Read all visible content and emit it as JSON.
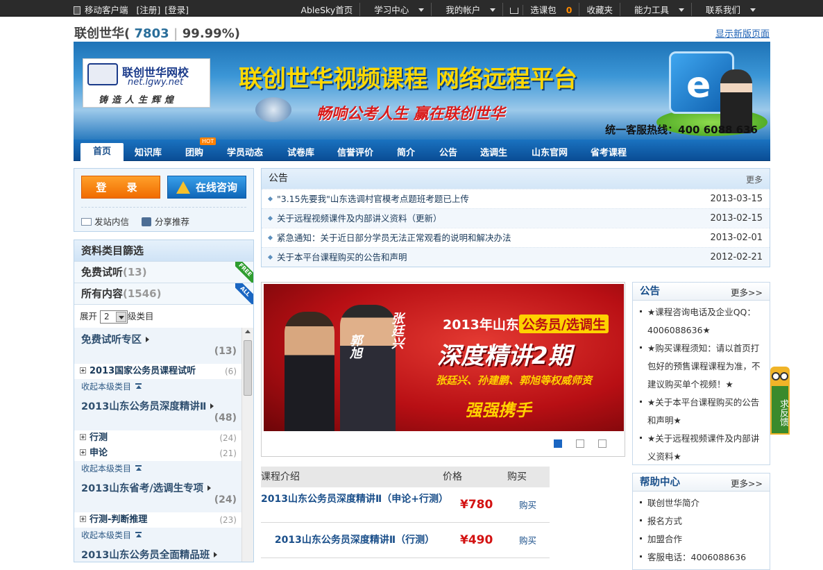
{
  "topbar": {
    "mobile": "移动客户端",
    "register": "[注册]",
    "login": "[登录]",
    "menu": [
      "AbleSky首页",
      "学习中心",
      "我的帐户",
      "选课包",
      "收藏夹",
      "能力工具",
      "联系我们"
    ],
    "cart_count": "0"
  },
  "header": {
    "name": "联创世华(",
    "count": "7803",
    "sep": "|",
    "rate": "99.99%)",
    "newver": "显示新版页面"
  },
  "banner": {
    "logo_cn": "联创世华网校",
    "logo_url": "net.lgwy.net",
    "logo_slogan": "铸造人生辉煌",
    "title": "联创世华视频课程   网络远程平台",
    "slogan": "畅响公考人生  赢在联创世华",
    "hotline": "统一客服热线：400 6088 636"
  },
  "nav": {
    "items": [
      "首页",
      "知识库",
      "团购",
      "学员动态",
      "试卷库",
      "信誉评价",
      "简介",
      "公告",
      "选调生",
      "山东官网",
      "省考课程"
    ],
    "hot": "HOT"
  },
  "loginbox": {
    "login": "登 录",
    "consult": "在线咨询",
    "msg": "发站内信",
    "share": "分享推荐"
  },
  "filter": {
    "title": "资料类目篩选",
    "free": "免费试听",
    "free_count": "(13)",
    "all": "所有内容",
    "all_count": "(1546)",
    "free_badge": "FREE",
    "all_badge": "ALL",
    "expand_prefix": "展开",
    "expand_value": "2",
    "expand_suffix": "级类目",
    "collapse": "收起本级类目"
  },
  "tree": [
    {
      "title": "免费试听专区",
      "count": "(13)",
      "items": [
        {
          "label": "2013国家公务员课程试听",
          "count": "(6)"
        }
      ]
    },
    {
      "title": "2013山东公务员深度精讲Ⅱ",
      "count": "(48)",
      "items": [
        {
          "label": "行测",
          "count": "(24)"
        },
        {
          "label": "申论",
          "count": "(21)"
        }
      ]
    },
    {
      "title": "2013山东省考/选调生专项",
      "count": "(24)",
      "items": [
        {
          "label": "行测-判断推理",
          "count": "(23)"
        }
      ]
    },
    {
      "title": "2013山东公务员全面精品班",
      "count": "",
      "items": []
    }
  ],
  "notice": {
    "title": "公告",
    "more": "更多",
    "rows": [
      {
        "text": "\"3.15先要我\"山东选调村官模考点题班考题已上传",
        "date": "2013-03-15"
      },
      {
        "text": "关于远程视频课件及内部讲义资料（更新）",
        "date": "2013-02-15"
      },
      {
        "text": "紧急通知：关于近日部分学员无法正常观看的说明和解决办法",
        "date": "2013-02-01"
      },
      {
        "text": "关于本平台课程购买的公告和声明",
        "date": "2012-02-21"
      }
    ]
  },
  "promo": {
    "name1": "郭旭",
    "name2": "张廷兴",
    "line1_a": "2013年山东",
    "line1_b": "公务员/选调生",
    "line2": "深度精讲2期",
    "line3": "张廷兴、孙建鹏、郭旭等权威师资",
    "line4": "强强携手"
  },
  "courses": {
    "head": [
      "课程介绍",
      "价格",
      "购买"
    ],
    "rows": [
      {
        "name": "2013山东公务员深度精讲Ⅱ（申论+行测）",
        "price": "¥780",
        "buy": "购买"
      },
      {
        "name": "2013山东公务员深度精讲Ⅱ（行测）",
        "price": "¥490",
        "buy": "购买"
      }
    ]
  },
  "side_notice": {
    "title": "公告",
    "more": "更多>>",
    "items": [
      "★课程咨询电话及企业QQ：4006088636★",
      "★购买课程须知：请以首页打包好的预售课程课程为准，不建议购买单个视频！★",
      "★关于本平台课程购买的公告和声明★",
      "★关于远程视频课件及内部讲义资料★"
    ]
  },
  "help": {
    "title": "帮助中心",
    "more": "更多>>",
    "items": [
      "联创世华简介",
      "报名方式",
      "加盟合作",
      "客服电话：4006088636"
    ]
  },
  "feedback": "求反馈"
}
